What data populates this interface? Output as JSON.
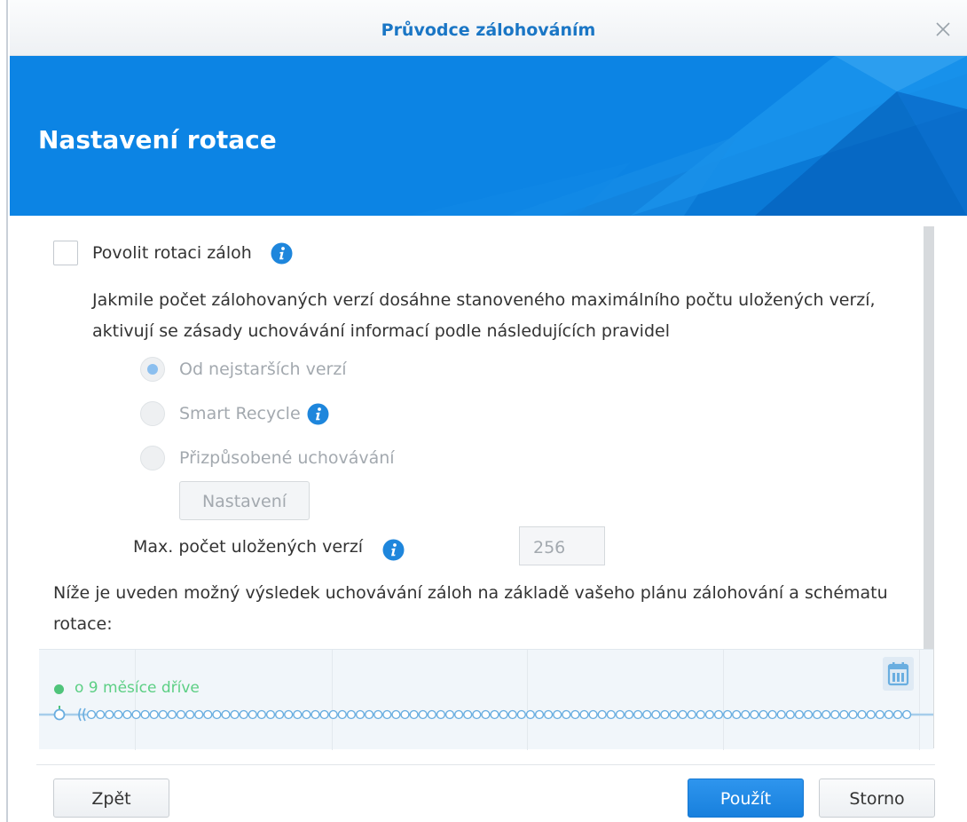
{
  "window": {
    "title": "Průvodce zálohováním",
    "banner_title": "Nastavení rotace"
  },
  "rotation": {
    "enable_label": "Povolit rotaci záloh",
    "enable_checked": false,
    "description": "Jakmile počet zálohovaných verzí dosáhne stanoveného maximálního počtu uložených verzí, aktivují se zásady uchovávání informací podle následujících pravidel",
    "options": [
      {
        "label": "Od nejstarších verzí",
        "checked": true
      },
      {
        "label": "Smart Recycle",
        "checked": false
      },
      {
        "label": "Přizpůsobené uchovávání",
        "checked": false
      }
    ],
    "settings_button": "Nastavení",
    "max_versions_label": "Max. počet uložených verzí",
    "max_versions_value": "256"
  },
  "preview": {
    "note": "Níže je uveden možný výsledek uchovávání záloh na základě vašeho plánu zálohování a schématu rotace:",
    "timeline_label": "o 9 měsíce dříve"
  },
  "footer": {
    "back_label": "Zpět",
    "apply_label": "Použít",
    "cancel_label": "Storno"
  },
  "colors": {
    "accent": "#1a76c5",
    "banner": "#0c84e4",
    "primary_button": "#1880dd",
    "timeline_green": "#5ccf84"
  },
  "icons": [
    "close-icon",
    "info-icon",
    "calendar-icon"
  ]
}
